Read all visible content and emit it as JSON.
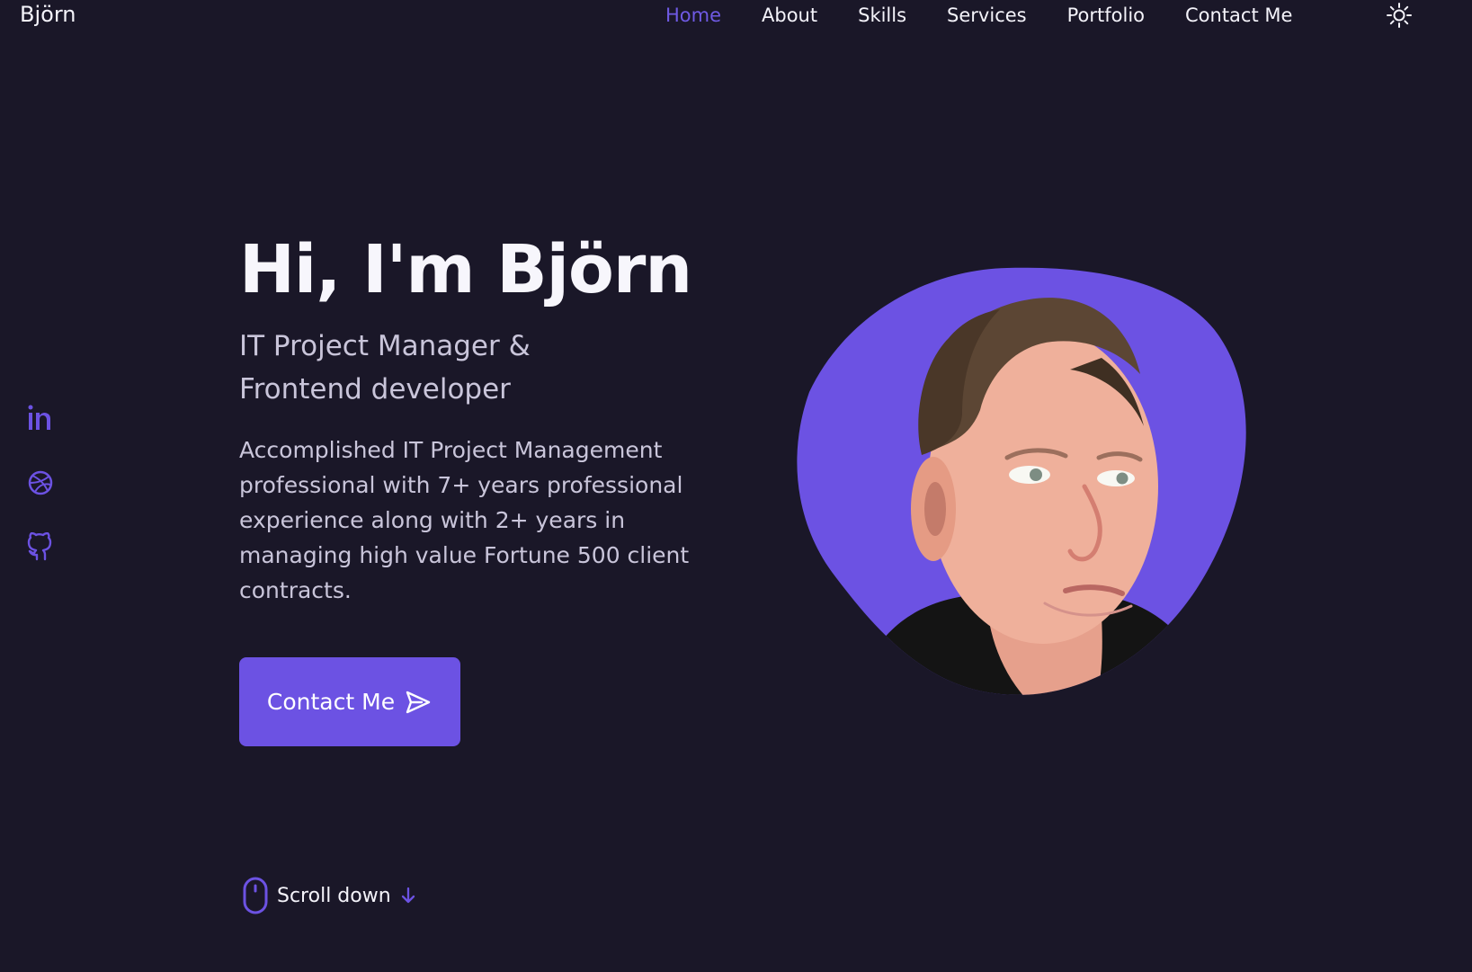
{
  "header": {
    "logo": "Björn",
    "nav": [
      {
        "label": "Home",
        "active": true
      },
      {
        "label": "About",
        "active": false
      },
      {
        "label": "Skills",
        "active": false
      },
      {
        "label": "Services",
        "active": false
      },
      {
        "label": "Portfolio",
        "active": false
      },
      {
        "label": "Contact Me",
        "active": false
      }
    ],
    "theme_icon": "sun-icon"
  },
  "social": [
    {
      "icon": "linkedin-icon"
    },
    {
      "icon": "dribbble-icon"
    },
    {
      "icon": "github-icon"
    }
  ],
  "home": {
    "title": "Hi, I'm Björn",
    "subtitle": "IT Project Manager & Frontend developer",
    "description": "Accomplished IT Project Management professional with 7+ years professional experience along with 2+ years in managing high value Fortune 500 client contracts.",
    "contact_button": {
      "label": "Contact Me",
      "icon": "send-icon"
    },
    "profile_image": {
      "icon": "profile-photo"
    },
    "scroll": {
      "label": "Scroll down",
      "mouse_icon": "mouse-icon",
      "arrow_icon": "arrow-down-icon"
    }
  },
  "colors": {
    "background": "#1a1728",
    "accent": "#6c52e3",
    "text": "#f4f3fa",
    "muted_text": "#c9c5da"
  }
}
